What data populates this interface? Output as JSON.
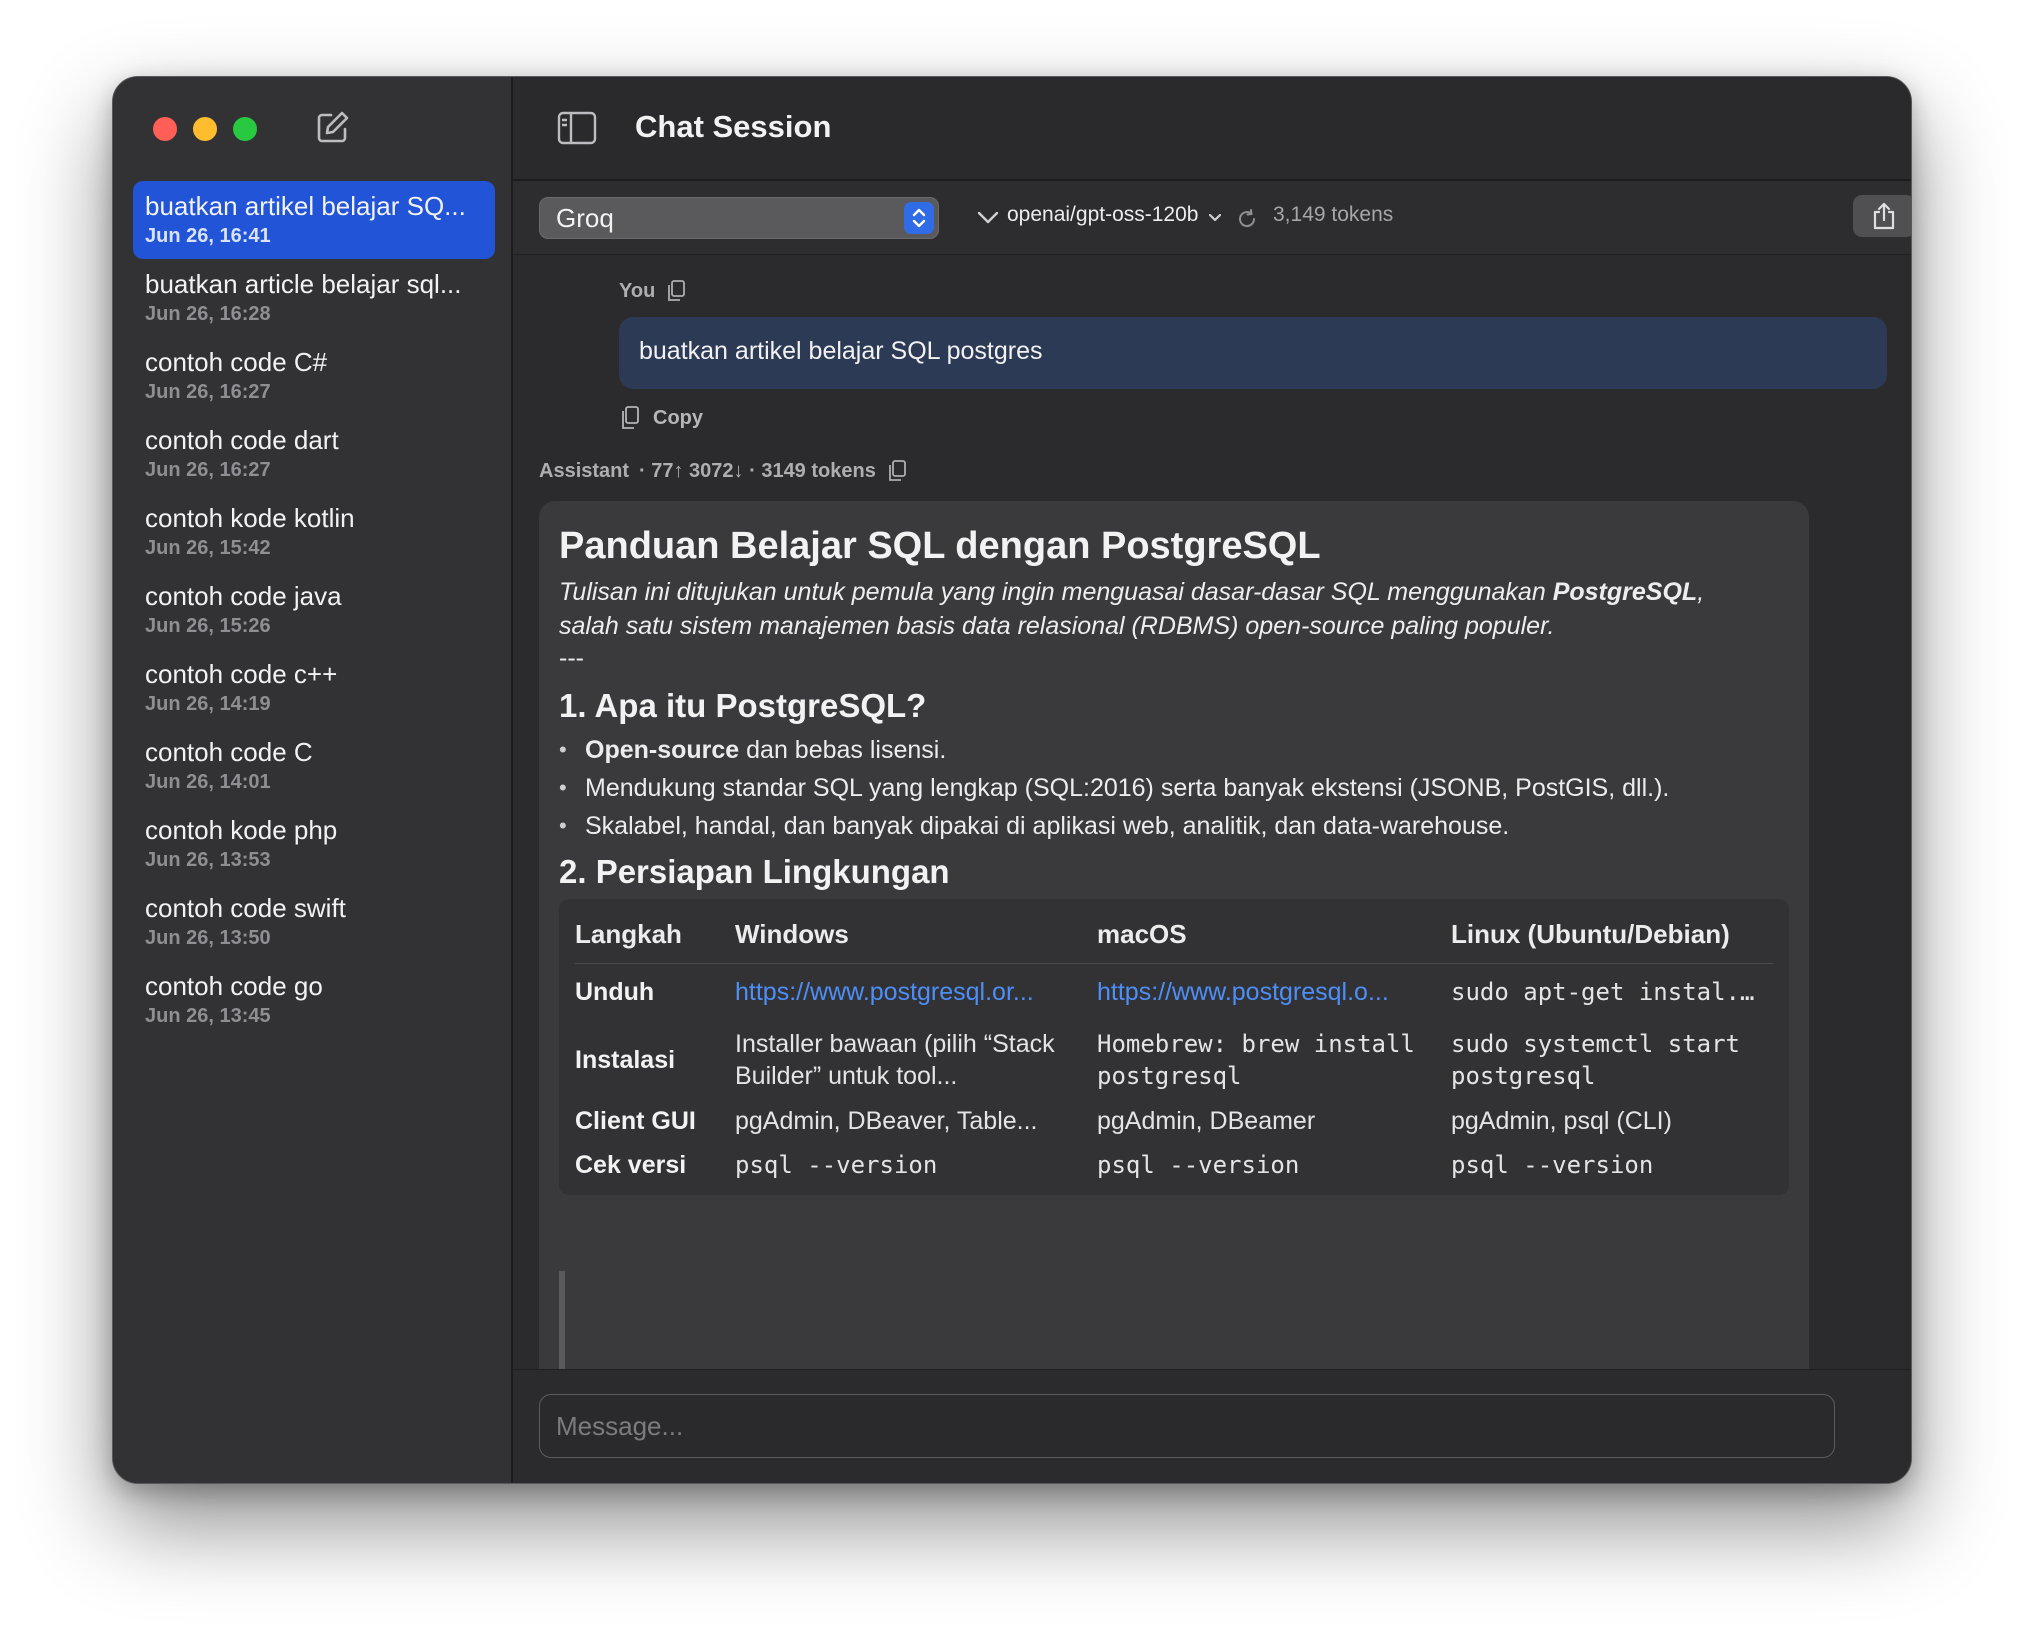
{
  "window": {
    "title": "Chat Session"
  },
  "sidebar": {
    "conversations": [
      {
        "title": "buatkan artikel belajar SQ...",
        "date": "Jun 26, 16:41",
        "active": true
      },
      {
        "title": "buatkan article belajar sql...",
        "date": "Jun 26, 16:28"
      },
      {
        "title": "contoh code C#",
        "date": "Jun 26, 16:27"
      },
      {
        "title": "contoh code dart",
        "date": "Jun 26, 16:27"
      },
      {
        "title": "contoh kode kotlin",
        "date": "Jun 26, 15:42"
      },
      {
        "title": "contoh code java",
        "date": "Jun 26, 15:26"
      },
      {
        "title": "contoh code c++",
        "date": "Jun 26, 14:19"
      },
      {
        "title": "contoh code C",
        "date": "Jun 26, 14:01"
      },
      {
        "title": "contoh kode php",
        "date": "Jun 26, 13:53"
      },
      {
        "title": "contoh code swift",
        "date": "Jun 26, 13:50"
      },
      {
        "title": "contoh code go",
        "date": "Jun 26, 13:45"
      }
    ]
  },
  "toolbar": {
    "provider": "Groq",
    "model": "openai/gpt-oss-120b",
    "tokens": "3,149 tokens"
  },
  "user_message": {
    "label": "You",
    "text": "buatkan artikel belajar SQL postgres",
    "copy_label": "Copy"
  },
  "assistant_message": {
    "label": "Assistant",
    "stats": "· 77↑ 3072↓ · 3149 tokens",
    "heading": "Panduan Belajar SQL dengan PostgreSQL",
    "intro_start": "Tulisan ini ditujukan untuk pemula yang ingin menguasai dasar-dasar SQL menggunakan ",
    "intro_bold": "PostgreSQL",
    "intro_end": ", salah satu sistem manajemen basis data relasional (RDBMS) open-source paling populer.",
    "separator": "---",
    "section1_title": "1. Apa itu PostgreSQL?",
    "bullet1_bold": "Open-source",
    "bullet1_rest": " dan bebas lisensi.",
    "bullet2": "Mendukung standar SQL yang lengkap (SQL:2016) serta banyak ekstensi (JSONB, PostGIS, dll.).",
    "bullet3": "Skalabel, handal, dan banyak dipakai di aplikasi web, analitik, dan data-warehouse.",
    "section2_title": "2. Persiapan Lingkungan",
    "table": {
      "headers": [
        "Langkah",
        "Windows",
        "macOS",
        "Linux (Ubuntu/Debian)"
      ],
      "rows": [
        [
          "Unduh",
          "https://www.postgresql.or...",
          "https://www.postgresql.o...",
          "sudo apt-get instal..."
        ],
        [
          "Instalasi",
          "Installer bawaan (pilih “Stack Builder” untuk tool...",
          "Homebrew: brew install postgresql",
          "sudo systemctl start postgresql"
        ],
        [
          "Client GUI",
          "pgAdmin, DBeaver, Table...",
          "pgAdmin, DBeamer",
          "pgAdmin, psql (CLI)"
        ],
        [
          "Cek versi",
          "psql --version",
          "psql --version",
          "psql --version"
        ]
      ]
    }
  },
  "composer": {
    "placeholder": "Message..."
  },
  "colors": {
    "accent": "#2154d6",
    "link": "#4d8ef7",
    "user_bubble": "#2c3a55"
  }
}
